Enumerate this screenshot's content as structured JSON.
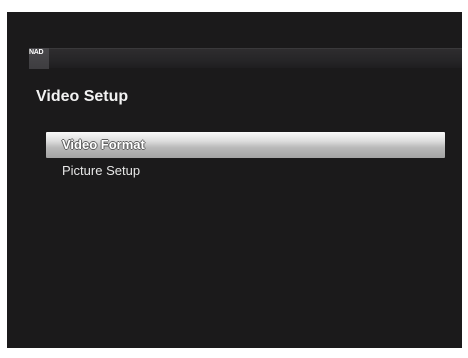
{
  "brand": {
    "logo_text": "NAD"
  },
  "page": {
    "title": "Video Setup"
  },
  "menu": {
    "items": [
      {
        "label": "Video Format",
        "selected": true
      },
      {
        "label": "Picture Setup",
        "selected": false
      }
    ]
  },
  "colors": {
    "background": "#1b1a1b",
    "highlight": "#dddddd",
    "text": "#e6e6e6"
  }
}
